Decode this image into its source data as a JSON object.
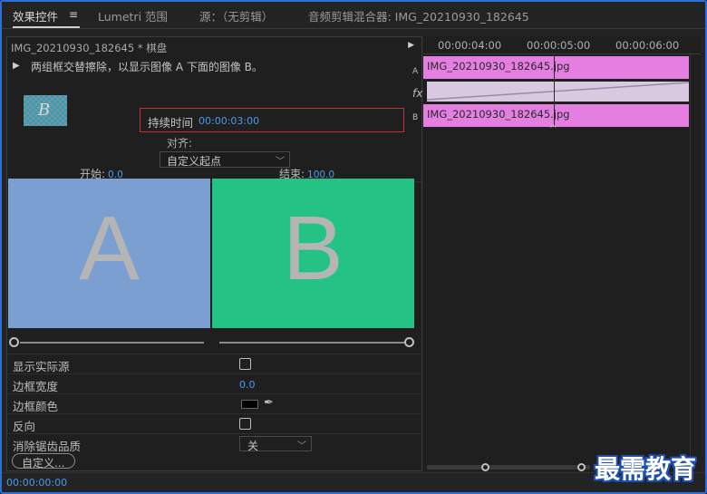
{
  "tabs": {
    "effect_controls": "效果控件",
    "lumetri": "Lumetri 范围",
    "source": "源：（无剪辑）",
    "audio_mixer": "音频剪辑混合器: IMG_20210930_182645"
  },
  "clip": {
    "header": "IMG_20210930_182645 * 棋盘",
    "description": "两组框交替擦除，以显示图像 A 下面的图像 B。"
  },
  "duration": {
    "label": "持续时间",
    "value": "00:00:03:00"
  },
  "alignment": {
    "label": "对齐:",
    "value": "自定义起点"
  },
  "ab": {
    "start_label": "开始:",
    "start_value": "0.0",
    "end_label": "结束:",
    "end_value": "100.0",
    "a": "A",
    "b": "B"
  },
  "properties": {
    "show_actual_sources": {
      "label": "显示实际源",
      "checked": false
    },
    "border_width": {
      "label": "边框宽度",
      "value": "0.0"
    },
    "border_color": {
      "label": "边框颜色",
      "color": "#000000"
    },
    "reverse": {
      "label": "反向",
      "checked": false
    },
    "anti_aliasing": {
      "label": "消除锯齿品质",
      "value": "关"
    }
  },
  "custom_button": "自定义...",
  "timecode": "00:00:00:00",
  "timeline": {
    "ticks": [
      "00:00:04:00",
      "00:00:05:00",
      "00:00:06:00"
    ],
    "track_a": "A",
    "track_b": "B",
    "fx": "fx",
    "clip_a": "IMG_20210930_182645.jpg",
    "clip_b": "IMG_20210930_182645.jpg"
  },
  "watermark": "最需教育",
  "colors": {
    "accent": "#4a9ae8",
    "clip": "#e47ee0",
    "panel_a": "#7b9fd0",
    "panel_b": "#25c286",
    "highlight_box": "#c43131"
  }
}
